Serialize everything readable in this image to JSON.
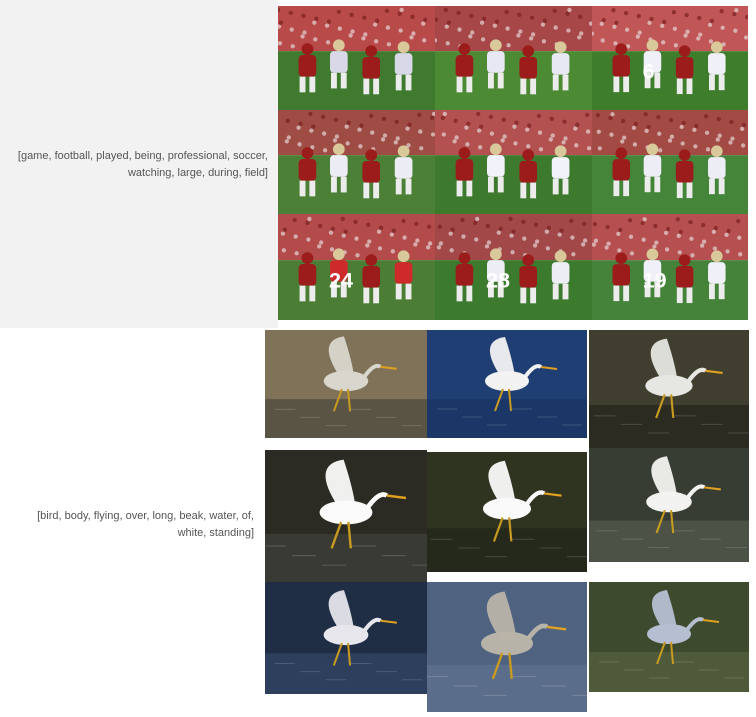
{
  "groups": [
    {
      "caption": "[game, football, played, being, professional, soccer, watching, large, during, field]",
      "images": [
        {
          "subject": "football",
          "jersey": "",
          "colors": {
            "sky": "#b94a4a",
            "ground": "#3f7a2f",
            "accent": "#d8d8e8"
          }
        },
        {
          "subject": "football",
          "jersey": "",
          "colors": {
            "sky": "#a84747",
            "ground": "#4c8a34",
            "accent": "#e8e8f4"
          }
        },
        {
          "subject": "football",
          "jersey": "6",
          "colors": {
            "sky": "#c05656",
            "ground": "#3e7d2c",
            "accent": "#f0f0f8"
          }
        },
        {
          "subject": "football",
          "jersey": "",
          "colors": {
            "sky": "#9e4c44",
            "ground": "#4d8037",
            "accent": "#ececf4"
          }
        },
        {
          "subject": "football",
          "jersey": "",
          "colors": {
            "sky": "#b35050",
            "ground": "#3d7a2e",
            "accent": "#f2f2fa"
          }
        },
        {
          "subject": "football",
          "jersey": "",
          "colors": {
            "sky": "#a34a44",
            "ground": "#44853a",
            "accent": "#ededf6"
          }
        },
        {
          "subject": "football",
          "jersey": "24",
          "colors": {
            "sky": "#b44b4b",
            "ground": "#4b7e34",
            "accent": "#cf2a2a"
          }
        },
        {
          "subject": "football",
          "jersey": "28",
          "colors": {
            "sky": "#a24848",
            "ground": "#3c7a2d",
            "accent": "#ededf5"
          }
        },
        {
          "subject": "football",
          "jersey": "19",
          "colors": {
            "sky": "#b65050",
            "ground": "#45823a",
            "accent": "#f0f0f8"
          }
        }
      ]
    },
    {
      "caption": "[bird, body, flying, over, long, beak, water, of, white, standing]",
      "images": [
        {
          "subject": "bird",
          "colors": {
            "bg": "#7f7258",
            "water": "#5a5444",
            "bird": "#d9d6ce"
          }
        },
        {
          "subject": "bird",
          "colors": {
            "bg": "#1f3e73",
            "water": "#1b3767",
            "bird": "#f2f2f2"
          }
        },
        {
          "subject": "bird",
          "colors": {
            "bg": "#3f3e2f",
            "water": "#2c2b22",
            "bird": "#e6e6e2"
          }
        },
        {
          "subject": "bird",
          "colors": {
            "bg": "#2b2b23",
            "water": "#393a33",
            "bird": "#fbfbfb"
          }
        },
        {
          "subject": "bird",
          "colors": {
            "bg": "#2f3420",
            "water": "#25291c",
            "bird": "#fafafa"
          }
        },
        {
          "subject": "bird",
          "colors": {
            "bg": "#383d33",
            "water": "#4c5246",
            "bird": "#f2f2f0"
          }
        },
        {
          "subject": "bird",
          "colors": {
            "bg": "#1f2d45",
            "water": "#2d3f5c",
            "bird": "#e6e6ec"
          }
        },
        {
          "subject": "bird",
          "colors": {
            "bg": "#4f6381",
            "water": "#5a6d8a",
            "bird": "#b8b3a8"
          }
        },
        {
          "subject": "bird",
          "colors": {
            "bg": "#3e4a2d",
            "water": "#4e5a3a",
            "bird": "#b6bfd2"
          }
        }
      ]
    }
  ]
}
